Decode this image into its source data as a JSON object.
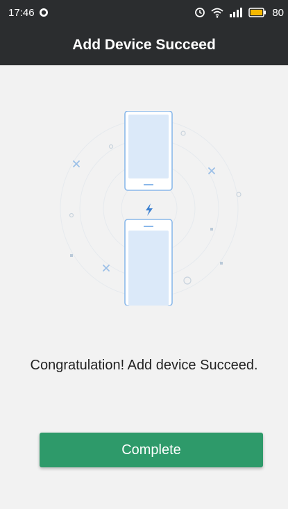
{
  "status_bar": {
    "time": "17:46",
    "battery": "80",
    "icons": [
      "target-icon",
      "alarm-icon",
      "wifi-icon",
      "signal-icon",
      "battery-icon"
    ]
  },
  "header": {
    "title": "Add Device Succeed"
  },
  "main": {
    "message": "Congratulation! Add device Succeed.",
    "complete_label": "Complete"
  },
  "colors": {
    "header_bg": "#2b2d2f",
    "background": "#f2f2f2",
    "button_bg": "#2e9a6a",
    "illustration_accent": "#8ab8ea"
  }
}
